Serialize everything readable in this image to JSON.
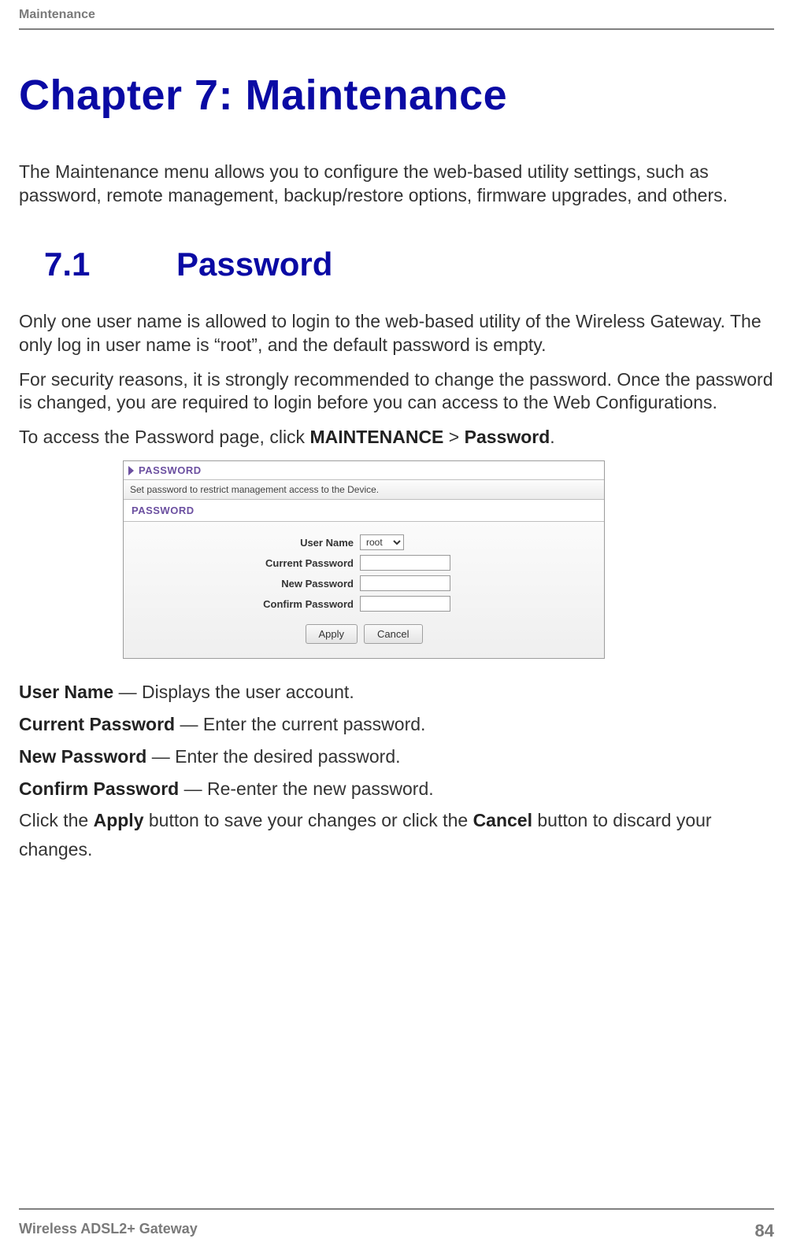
{
  "header": {
    "section": "Maintenance"
  },
  "chapter": {
    "title": "Chapter 7:  Maintenance",
    "intro": "The Maintenance menu allows you to configure the web-based utility settings, such as password, remote management, backup/restore options, firmware upgrades, and others."
  },
  "section": {
    "number": "7.1",
    "title": "Password",
    "para1": "Only one user name is allowed to login to the web-based utility of the Wireless Gateway. The only log in user name is “root”, and the default password is empty.",
    "para2": "For security reasons, it is strongly recommended to change the password. Once the password is changed, you are required to login before you can access to the Web Configurations.",
    "access_pre": "To access the Password page, click ",
    "access_b1": "MAINTENANCE",
    "access_gt": " > ",
    "access_b2": "Password",
    "access_post": "."
  },
  "panel": {
    "title": "PASSWORD",
    "caption": "Set password to restrict management access to the Device.",
    "subtitle": "PASSWORD",
    "labels": {
      "user_name": "User Name",
      "current_pw": "Current Password",
      "new_pw": "New Password",
      "confirm_pw": "Confirm Password"
    },
    "user_option": "root",
    "buttons": {
      "apply": "Apply",
      "cancel": "Cancel"
    }
  },
  "definitions": {
    "user_name_b": "User Name",
    "user_name_t": " — Displays the user account.",
    "current_b": "Current Password",
    "current_t": " — Enter the current password.",
    "new_b": "New Password",
    "new_t": " — Enter the desired password.",
    "confirm_b": "Confirm Password",
    "confirm_t": " — Re-enter the new password.",
    "final_pre": "Click the ",
    "final_b1": "Apply",
    "final_mid": " button to save your changes or click the ",
    "final_b2": "Cancel",
    "final_post": " button to discard your changes."
  },
  "footer": {
    "product": "Wireless ADSL2+ Gateway",
    "page": "84"
  }
}
